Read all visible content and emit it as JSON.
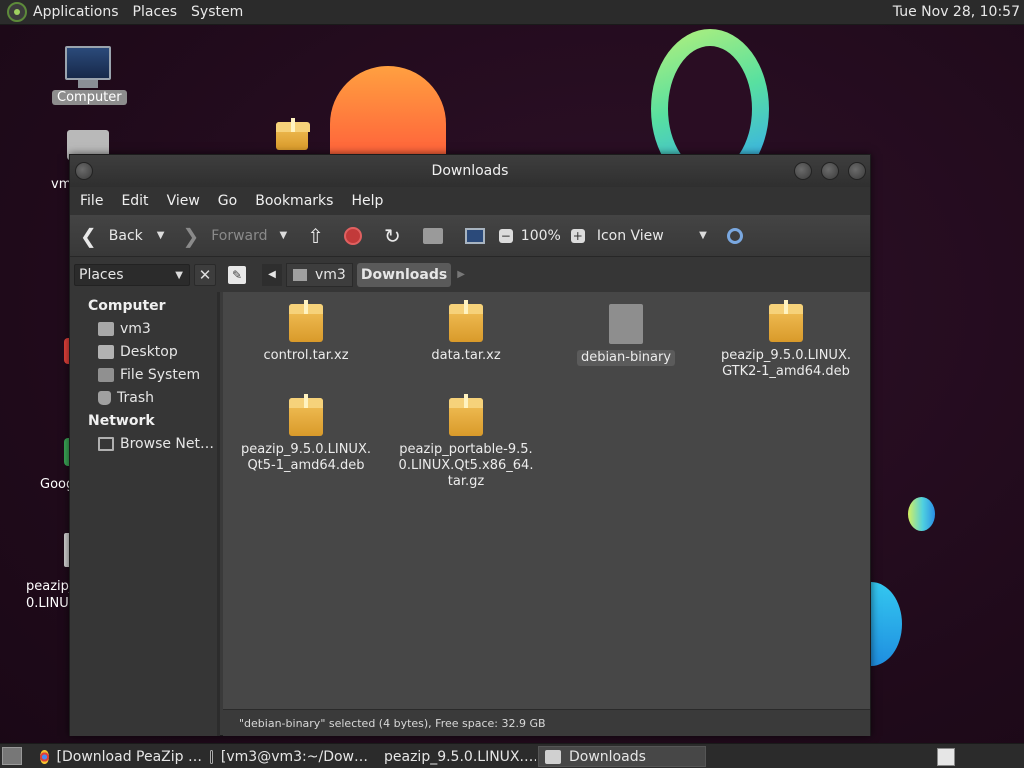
{
  "top_panel": {
    "menus": [
      "Applications",
      "Places",
      "System"
    ],
    "clock": "Tue Nov 28, 10:57"
  },
  "desktop": {
    "icons": {
      "computer": "Computer",
      "vm3": "vm",
      "google": "Goog",
      "peazip_line1": "peazip_",
      "peazip_line2": "0.LINU"
    }
  },
  "window": {
    "title": "Downloads",
    "menus": [
      "File",
      "Edit",
      "View",
      "Go",
      "Bookmarks",
      "Help"
    ],
    "toolbar": {
      "back": "Back",
      "forward": "Forward",
      "zoom": "100%",
      "view_mode": "Icon View"
    },
    "sidebar": {
      "selector": "Places",
      "sections": [
        {
          "title": "Computer",
          "items": [
            "vm3",
            "Desktop",
            "File System",
            "Trash"
          ]
        },
        {
          "title": "Network",
          "items": [
            "Browse Net…"
          ]
        }
      ]
    },
    "path": [
      "vm3",
      "Downloads"
    ],
    "files": [
      {
        "line1": "control.tar.xz",
        "line2": "",
        "line3": "",
        "type": "package"
      },
      {
        "line1": "data.tar.xz",
        "line2": "",
        "line3": "",
        "type": "package"
      },
      {
        "line1": "debian-binary",
        "line2": "",
        "line3": "",
        "type": "document",
        "selected": true
      },
      {
        "line1": "peazip_9.5.0.LINUX.",
        "line2": "GTK2-1_amd64.deb",
        "line3": "",
        "type": "package"
      },
      {
        "line1": "peazip_9.5.0.LINUX.",
        "line2": "Qt5-1_amd64.deb",
        "line3": "",
        "type": "package"
      },
      {
        "line1": "peazip_portable-9.5.",
        "line2": "0.LINUX.Qt5.x86_64.",
        "line3": "tar.gz",
        "type": "package"
      }
    ],
    "status": "\"debian-binary\" selected (4 bytes), Free space: 32.9 GB"
  },
  "bottom_panel": {
    "tasks": [
      "[Download PeaZip …",
      "[vm3@vm3:~/Dow…",
      "peazip_9.5.0.LINUX.…",
      "Downloads"
    ]
  },
  "colors": {
    "panel": "#2b2b2b",
    "window_bg": "#3a3a3a",
    "content_bg": "#474747",
    "package_icon": "#e8b040"
  }
}
